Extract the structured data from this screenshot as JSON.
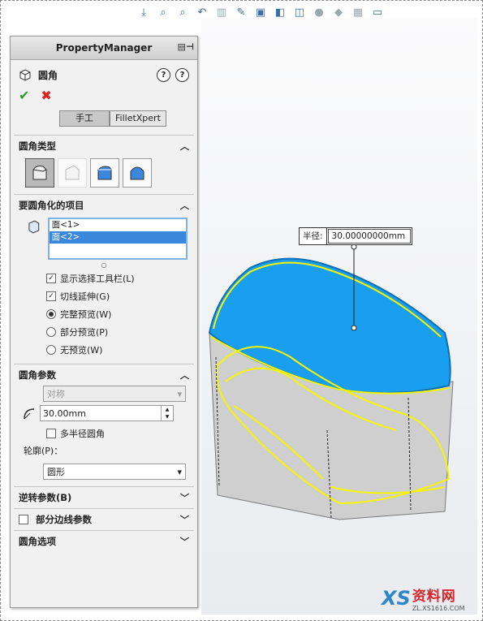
{
  "toolbar": {
    "icons": [
      "view-orient-icon",
      "zoom-fit-icon",
      "zoom-area-icon",
      "previous-view-icon",
      "section-view-icon",
      "dynamic-annotation-icon",
      "view-orientation-icon",
      "display-style-icon",
      "hide-show-icon",
      "edit-appearance-icon",
      "apply-scene-icon",
      "view-settings-icon",
      "display-icon"
    ]
  },
  "property_manager": {
    "header": "PropertyManager",
    "feature_title": "圆角",
    "tabs": {
      "manual": "手工",
      "filletxpert": "FilletXpert"
    }
  },
  "fillet_type": {
    "label": "圆角类型",
    "buttons": [
      "constant-size-fillet",
      "variable-size-fillet",
      "face-fillet",
      "full-round-fillet"
    ],
    "selected": 0
  },
  "items_to_fillet": {
    "label": "要圆角化的项目",
    "list": [
      "面<1>",
      "面<2>"
    ],
    "selected_index": 1,
    "options": {
      "show_selection_toolbar": "显示选择工具栏(L)",
      "tangent_propagation": "切线延伸(G)",
      "full_preview": "完整预览(W)",
      "partial_preview": "部分预览(P)",
      "no_preview": "无预览(W)"
    },
    "checked": {
      "show_selection_toolbar": true,
      "tangent_propagation": true
    },
    "preview_mode": "full"
  },
  "fillet_params": {
    "label": "圆角参数",
    "method": "对称",
    "radius": "30.00mm",
    "multi_radius": "多半径圆角",
    "multi_radius_checked": false,
    "profile_label": "轮廓(P)：",
    "profile": "圆形"
  },
  "setback": {
    "label": "逆转参数(B)"
  },
  "partial_edge": {
    "label": "部分边线参数",
    "checked": false
  },
  "fillet_options": {
    "label": "圆角选项"
  },
  "callout": {
    "label": "半径:",
    "value": "30.00000000mm"
  },
  "colors": {
    "model_highlight": "#1a9ff0",
    "edge_preview": "#f5f500",
    "body": "#c9c9c9"
  },
  "watermark": {
    "title": "资料网",
    "url": "ZL.XS1616.COM"
  }
}
